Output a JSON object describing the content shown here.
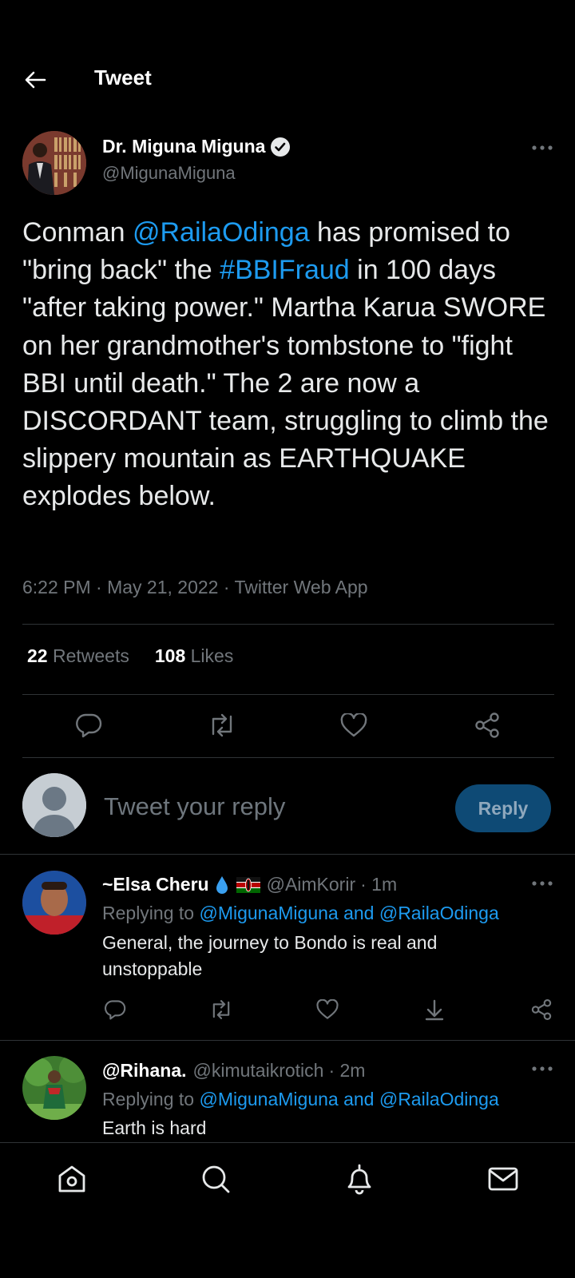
{
  "header": {
    "title": "Tweet"
  },
  "tweet": {
    "author_name": "Dr. Miguna Miguna",
    "author_handle": "@MigunaMiguna",
    "text_parts": {
      "p1": "Conman ",
      "mention": "@RailaOdinga",
      "p2": " has promised to \"bring back\" the ",
      "hashtag": "#BBIFraud",
      "p3": " in 100 days \"after taking power.\" Martha Karua SWORE on her grandmother's tombstone to \"fight BBI until death.\" The 2 are now a DISCORDANT team, struggling to climb the slippery mountain as EARTHQUAKE explodes below."
    },
    "meta": "6:22 PM · May 21, 2022 · Twitter Web App",
    "retweets_count": "22",
    "retweets_label": "Retweets",
    "likes_count": "108",
    "likes_label": "Likes"
  },
  "compose": {
    "placeholder": "Tweet your reply",
    "button": "Reply"
  },
  "replies": [
    {
      "name": "~Elsa Cheru",
      "handle": "@AimKorir",
      "time": "· 1m",
      "replying_prefix": "Replying to ",
      "replying_to": "@MigunaMiguna and @RailaOdinga",
      "text": "General, the journey to Bondo is real and unstoppable"
    },
    {
      "name": "@Rihana.",
      "handle": "@kimutaikrotich",
      "time": "· 2m",
      "replying_prefix": "Replying to ",
      "replying_to": "@MigunaMiguna and @RailaOdinga",
      "text": "Earth is hard"
    }
  ],
  "icons": {
    "back": "back-arrow-icon",
    "verified": "verified-badge-icon",
    "more": "more-icon",
    "reply": "reply-icon",
    "retweet": "retweet-icon",
    "like": "like-icon",
    "share": "share-icon",
    "download": "download-icon",
    "home": "home-icon",
    "search": "search-icon",
    "notifications": "bell-icon",
    "messages": "mail-icon"
  },
  "colors": {
    "background": "#000000",
    "link": "#1d9bf0",
    "muted": "#71767b",
    "reply_button": "#0e4a75"
  }
}
